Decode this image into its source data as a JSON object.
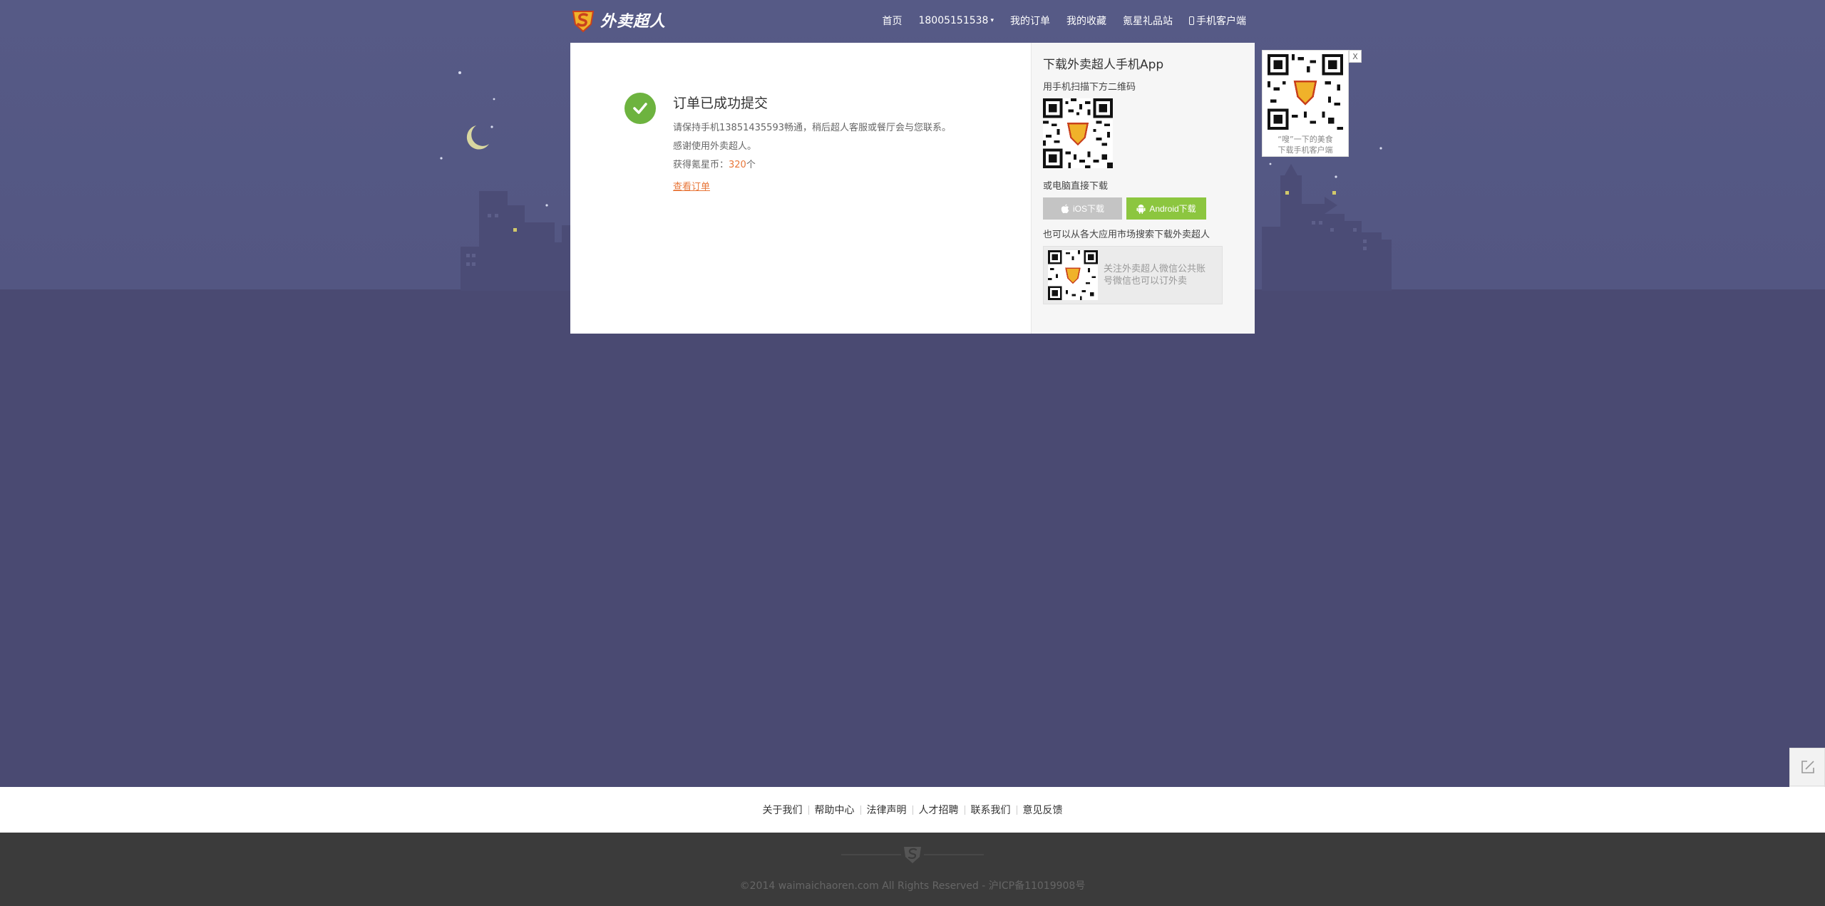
{
  "header": {
    "brand": "外卖超人",
    "nav": [
      {
        "label": "首页"
      },
      {
        "label": "18005151538"
      },
      {
        "label": "我的订单"
      },
      {
        "label": "我的收藏"
      },
      {
        "label": "氪星礼品站"
      },
      {
        "label": "手机客户端"
      }
    ]
  },
  "success": {
    "title": "订单已成功提交",
    "line1": "请保持手机13851435593畅通，稍后超人客服或餐厅会与您联系。",
    "line2": "感谢使用外卖超人。",
    "coins_prefix": "获得氪星币：",
    "coins_value": "320",
    "coins_suffix": "个",
    "view_order": "查看订单"
  },
  "app_panel": {
    "title": "下载外卖超人手机App",
    "scan_text": "用手机扫描下方二维码",
    "direct_text": "或电脑直接下载",
    "ios_label": "iOS下载",
    "android_label": "Android下载",
    "market_text": "也可以从各大应用市场搜索下载外卖超人",
    "wechat_line1": "关注外卖超人微信公共账",
    "wechat_line2": "号微信也可以订外卖"
  },
  "float_qr": {
    "close": "X",
    "caption1": "“嗖”一下的美食",
    "caption2": "下载手机客户端"
  },
  "footer": {
    "links": [
      "关于我们",
      "帮助中心",
      "法律声明",
      "人才招聘",
      "联系我们",
      "意见反馈"
    ],
    "copyright": "©2014 waimaichaoren.com All Rights Reserved - 沪ICP备11019908号"
  },
  "colors": {
    "sky": "#565a86",
    "ground": "#4a4a72",
    "success_green": "#6db33f",
    "android_green": "#8cc63f",
    "accent_orange": "#e8773a"
  }
}
